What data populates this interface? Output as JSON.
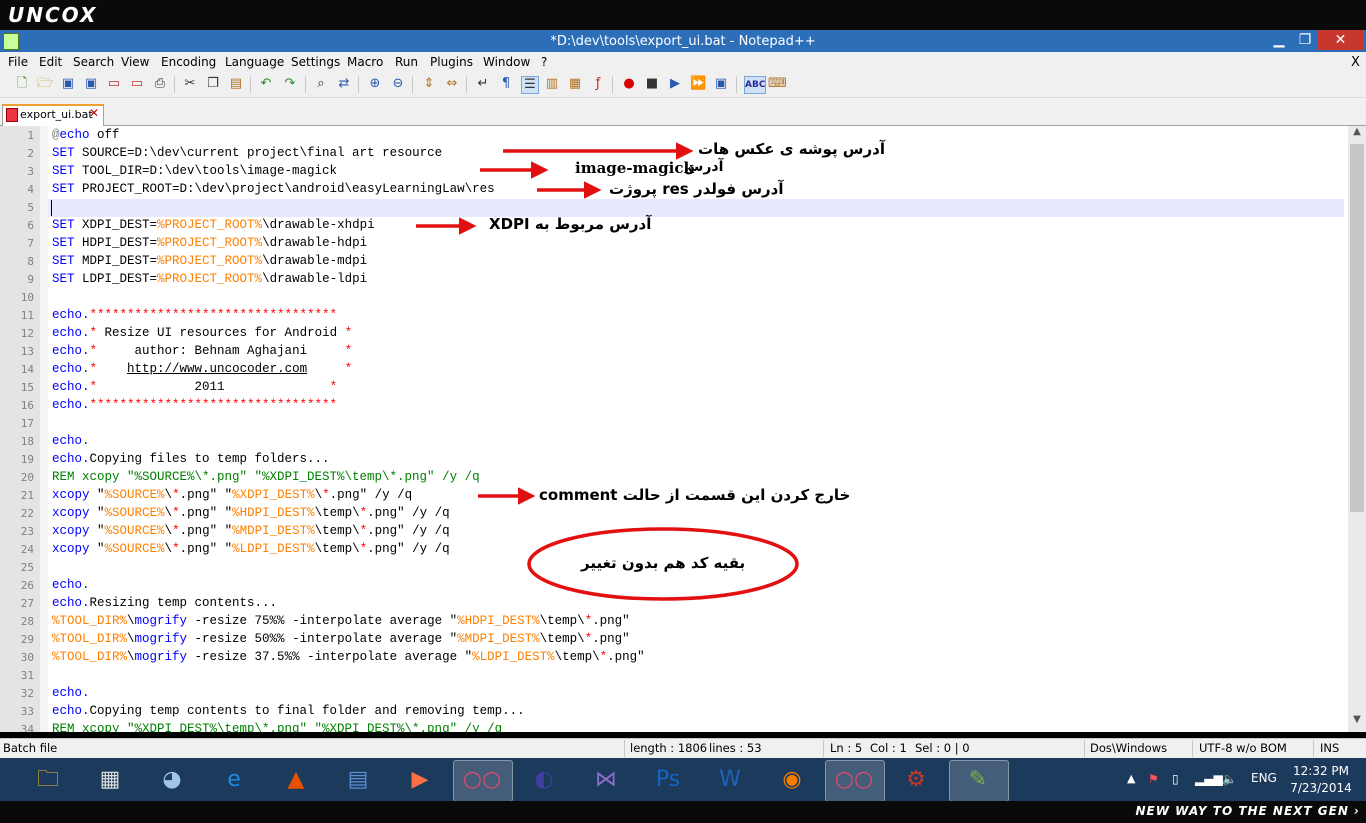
{
  "brand": {
    "logo": "UNCOX",
    "slogan": "NEW WAY TO THE NEXT GEN ›"
  },
  "window": {
    "title": "*D:\\dev\\tools\\export_ui.bat - Notepad++",
    "min": "▁",
    "max": "❐",
    "close": "✕"
  },
  "menu": [
    "File",
    "Edit",
    "Search",
    "View",
    "Encoding",
    "Language",
    "Settings",
    "Macro",
    "Run",
    "Plugins",
    "Window",
    "?"
  ],
  "menu_close": "X",
  "tab": {
    "label": "export_ui.bat",
    "close": "✕"
  },
  "line_numbers": [
    "1",
    "2",
    "3",
    "4",
    "5",
    "6",
    "7",
    "8",
    "9",
    "10",
    "11",
    "12",
    "13",
    "14",
    "15",
    "16",
    "17",
    "18",
    "19",
    "20",
    "21",
    "22",
    "23",
    "24",
    "25",
    "26",
    "27",
    "28",
    "29",
    "30",
    "31",
    "32",
    "33",
    "34"
  ],
  "code": {
    "l1": {
      "at": "@",
      "kw": "echo",
      "rest": " off"
    },
    "l2": {
      "kw": "SET",
      "rest": " SOURCE=D:\\dev\\current project\\final art resource"
    },
    "l3": {
      "kw": "SET",
      "rest": " TOOL_DIR=D:\\dev\\tools\\image-magick"
    },
    "l4": {
      "kw": "SET",
      "rest": " PROJECT_ROOT=D:\\dev\\project\\android\\easyLearningLaw\\res"
    },
    "l6": {
      "kw": "SET",
      "a": " XDPI_DEST=",
      "v": "%PROJECT_ROOT%",
      "b": "\\drawable-xhdpi"
    },
    "l7": {
      "kw": "SET",
      "a": " HDPI_DEST=",
      "v": "%PROJECT_ROOT%",
      "b": "\\drawable-hdpi"
    },
    "l8": {
      "kw": "SET",
      "a": " MDPI_DEST=",
      "v": "%PROJECT_ROOT%",
      "b": "\\drawable-mdpi"
    },
    "l9": {
      "kw": "SET",
      "a": " LDPI_DEST=",
      "v": "%PROJECT_ROOT%",
      "b": "\\drawable-ldpi"
    },
    "l11": {
      "kw": "echo.",
      "stars": "*********************************"
    },
    "l12": {
      "kw": "echo.",
      "s1": "*",
      "t": " Resize UI resources for Android ",
      "s2": "*"
    },
    "l13": {
      "kw": "echo.",
      "s1": "*",
      "t": "     author: Behnam Aghajani     ",
      "s2": "*"
    },
    "l14": {
      "kw": "echo.",
      "s1": "*",
      "t1": "    ",
      "link": "http://www.uncocoder.com",
      "t2": "     ",
      "s2": "*"
    },
    "l15": {
      "kw": "echo.",
      "s1": "*",
      "t": "             2011              ",
      "s2": "*"
    },
    "l16": {
      "kw": "echo.",
      "stars": "*********************************"
    },
    "l18": {
      "kw": "echo."
    },
    "l19": {
      "kw": "echo.",
      "rest": "Copying files to temp folders..."
    },
    "l20": {
      "text": "REM xcopy \"%SOURCE%\\*.png\" \"%XDPI_DEST%\\temp\\*.png\" /y /q"
    },
    "l21": {
      "kw": "xcopy",
      "q1": " \"",
      "v1": "%SOURCE%",
      "m1": "\\",
      "st1": "*",
      "m2": ".png\" \"",
      "v2": "%XDPI_DEST%",
      "m3": "\\",
      "st2": "*",
      "m4": ".png\" /y /q"
    },
    "l22": {
      "kw": "xcopy",
      "q1": " \"",
      "v1": "%SOURCE%",
      "m1": "\\",
      "st1": "*",
      "m2": ".png\" \"",
      "v2": "%HDPI_DEST%",
      "m3": "\\temp\\",
      "st2": "*",
      "m4": ".png\" /y /q"
    },
    "l23": {
      "kw": "xcopy",
      "q1": " \"",
      "v1": "%SOURCE%",
      "m1": "\\",
      "st1": "*",
      "m2": ".png\" \"",
      "v2": "%MDPI_DEST%",
      "m3": "\\temp\\",
      "st2": "*",
      "m4": ".png\" /y /q"
    },
    "l24": {
      "kw": "xcopy",
      "q1": " \"",
      "v1": "%SOURCE%",
      "m1": "\\",
      "st1": "*",
      "m2": ".png\" \"",
      "v2": "%LDPI_DEST%",
      "m3": "\\temp\\",
      "st2": "*",
      "m4": ".png\" /y /q"
    },
    "l26": {
      "kw": "echo."
    },
    "l27": {
      "kw": "echo.",
      "rest": "Resizing temp contents..."
    },
    "l28": {
      "v1": "%TOOL_DIR%",
      "m1": "\\",
      "kw": "mogrify",
      "r": " -resize 75%% -interpolate average \"",
      "v2": "%HDPI_DEST%",
      "m2": "\\temp\\",
      "st": "*",
      "e": ".png\""
    },
    "l29": {
      "v1": "%TOOL_DIR%",
      "m1": "\\",
      "kw": "mogrify",
      "r": " -resize 50%% -interpolate average \"",
      "v2": "%MDPI_DEST%",
      "m2": "\\temp\\",
      "st": "*",
      "e": ".png\""
    },
    "l30": {
      "v1": "%TOOL_DIR%",
      "m1": "\\",
      "kw": "mogrify",
      "r": " -resize 37.5%% -interpolate average \"",
      "v2": "%LDPI_DEST%",
      "m2": "\\temp\\",
      "st": "*",
      "e": ".png\""
    },
    "l32": {
      "kw": "echo."
    },
    "l33": {
      "kw": "echo.",
      "rest": "Copying temp contents to final folder and removing temp..."
    },
    "l34": {
      "text": "REM xcopy \"%XDPI_DEST%\\temp\\*.png\" \"%XDPI_DEST%\\*.png\" /y /q"
    }
  },
  "annotations": {
    "a1": "آدرس پوشه ی عکس هات",
    "a2_fa": "آدرس",
    "a2_en": "image-magick",
    "a3": "آدرس فولدر res پروژت",
    "a4": "آدرس مربوط به XDPI",
    "a5": "خارج کردن این قسمت از حالت comment",
    "a6": "بقیه کد هم بدون تغییر"
  },
  "status": {
    "type": "Batch file",
    "length": "length : 1806",
    "lines": "lines : 53",
    "ln": "Ln : 5",
    "col": "Col : 1",
    "sel": "Sel : 0 | 0",
    "eol": "Dos\\Windows",
    "encoding": "UTF-8 w/o BOM",
    "mode": "INS"
  },
  "taskbar": {
    "items": [
      {
        "name": "file-explorer",
        "glyph": "🗀"
      },
      {
        "name": "system-monitor",
        "glyph": "▦"
      },
      {
        "name": "fish-app",
        "glyph": "◕"
      },
      {
        "name": "internet-explorer",
        "glyph": "e"
      },
      {
        "name": "matlab",
        "glyph": "▲"
      },
      {
        "name": "book-app",
        "glyph": "▤"
      },
      {
        "name": "media-player",
        "glyph": "▶"
      },
      {
        "name": "flickr-app-1",
        "glyph": "○○"
      },
      {
        "name": "eclipse",
        "glyph": "◐"
      },
      {
        "name": "visual-studio",
        "glyph": "⋈"
      },
      {
        "name": "photoshop",
        "glyph": "Ps"
      },
      {
        "name": "word",
        "glyph": "W"
      },
      {
        "name": "firefox",
        "glyph": "◉"
      },
      {
        "name": "flickr-app-2",
        "glyph": "○○"
      },
      {
        "name": "java-ee-ide",
        "glyph": "⚙"
      },
      {
        "name": "notepad-plus-plus",
        "glyph": "✎"
      }
    ],
    "lang": "ENG",
    "time": "12:32 PM",
    "date": "7/23/2014"
  }
}
